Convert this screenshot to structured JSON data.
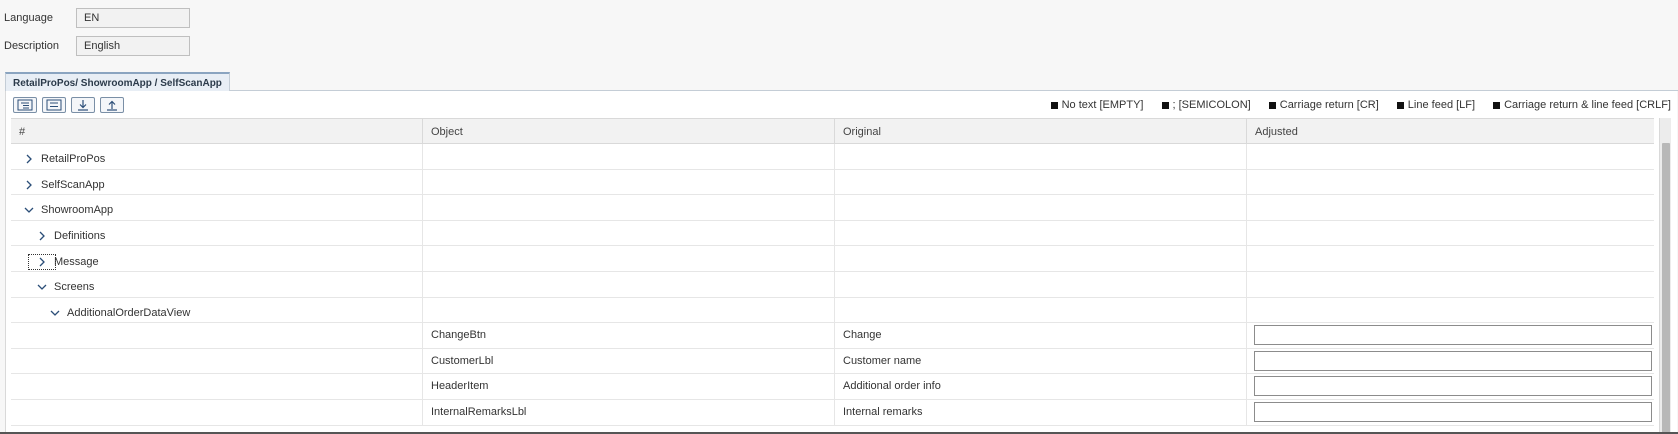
{
  "fields": {
    "language": {
      "label": "Language",
      "value": "EN"
    },
    "description": {
      "label": "Description",
      "value": "English"
    }
  },
  "tab": {
    "label": "RetailProPos/ ShowroomApp / SelfScanApp"
  },
  "toolbar": {
    "buttons": [
      "expand-all-icon",
      "collapse-all-icon",
      "download-icon",
      "upload-icon"
    ]
  },
  "legend": [
    "No text [EMPTY]",
    "; [SEMICOLON]",
    "Carriage return [CR]",
    "Line feed [LF]",
    "Carriage return & line feed [CRLF]"
  ],
  "grid": {
    "columns": [
      "#",
      "Object",
      "Original",
      "Adjusted"
    ],
    "tree_rows": [
      {
        "label": "RetailProPos",
        "level": 0,
        "state": "collapsed"
      },
      {
        "label": "SelfScanApp",
        "level": 0,
        "state": "collapsed"
      },
      {
        "label": "ShowroomApp",
        "level": 0,
        "state": "expanded"
      },
      {
        "label": "Definitions",
        "level": 1,
        "state": "collapsed"
      },
      {
        "label": "Message",
        "level": 1,
        "state": "collapsed"
      },
      {
        "label": "Screens",
        "level": 1,
        "state": "expanded"
      },
      {
        "label": "AdditionalOrderDataView",
        "level": 2,
        "state": "expanded"
      }
    ],
    "data_rows": [
      {
        "object": "ChangeBtn",
        "original": "Change",
        "adjusted": ""
      },
      {
        "object": "CustomerLbl",
        "original": "Customer name",
        "adjusted": ""
      },
      {
        "object": "HeaderItem",
        "original": "Additional order info",
        "adjusted": ""
      },
      {
        "object": "InternalRemarksLbl",
        "original": "Internal remarks",
        "adjusted": ""
      }
    ]
  },
  "colors": {
    "accent": "#8aa4c0",
    "tab_bg": "#e8eef5",
    "header_bg": "#f2f2f2"
  }
}
